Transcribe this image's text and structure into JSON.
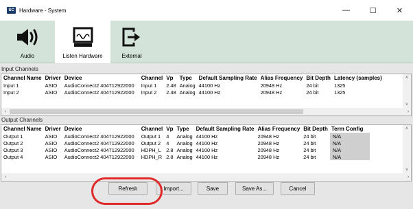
{
  "window": {
    "app_icon_text": "SC",
    "title": "Hardware - System",
    "minimize_glyph": "—",
    "maximize_glyph": "☐",
    "close_glyph": "✕"
  },
  "toolbar": {
    "tools": [
      {
        "label": "Audio",
        "icon": "speaker-icon",
        "active": false
      },
      {
        "label": "Listen Hardware",
        "icon": "monitor-icon",
        "active": true
      },
      {
        "label": "External",
        "icon": "external-arrow-icon",
        "active": false
      }
    ]
  },
  "input_channels": {
    "label": "Input Channels",
    "columns": [
      "Channel Name",
      "Driver",
      "Device",
      "Channel",
      "Vp",
      "Type",
      "Default Sampling Rate",
      "Alias Frequency",
      "Bit Depth",
      "Latency (samples)"
    ],
    "rows": [
      [
        "Input 1",
        "ASIO",
        "AudioConnect2 404712922000",
        "Input 1",
        "2.48",
        "Analog",
        "44100 Hz",
        "20948 Hz",
        "24 bit",
        "1325"
      ],
      [
        "Input 2",
        "ASIO",
        "AudioConnect2 404712922000",
        "Input 2",
        "2.48",
        "Analog",
        "44100 Hz",
        "20948 Hz",
        "24 bit",
        "1325"
      ]
    ]
  },
  "output_channels": {
    "label": "Output Channels",
    "columns": [
      "Channel Name",
      "Driver",
      "Device",
      "Channel",
      "Vp",
      "Type",
      "Default Sampling Rate",
      "Alias Frequency",
      "Bit Depth",
      "Term Config"
    ],
    "rows": [
      [
        "Output 1",
        "ASIO",
        "AudioConnect2 404712922000",
        "Output 1",
        "4",
        "Analog",
        "44100 Hz",
        "20948 Hz",
        "24 bit",
        "N/A"
      ],
      [
        "Output 2",
        "ASIO",
        "AudioConnect2 404712922000",
        "Output 2",
        "4",
        "Analog",
        "44100 Hz",
        "20948 Hz",
        "24 bit",
        "N/A"
      ],
      [
        "Output 3",
        "ASIO",
        "AudioConnect2 404712922000",
        "HDPH_L",
        "2.8",
        "Analog",
        "44100 Hz",
        "20948 Hz",
        "24 bit",
        "N/A"
      ],
      [
        "Output 4",
        "ASIO",
        "AudioConnect2 404712922000",
        "HDPH_R",
        "2.8",
        "Analog",
        "44100 Hz",
        "20948 Hz",
        "24 bit",
        "N/A"
      ]
    ]
  },
  "buttons": {
    "refresh": "Refresh",
    "import": "Import...",
    "save": "Save",
    "save_as": "Save As...",
    "cancel": "Cancel"
  },
  "scroll_glyphs": {
    "up": "˄",
    "down": "˅",
    "left": "‹",
    "right": "›"
  },
  "colors": {
    "toolbar_bg": "#d3e3d9",
    "highlight_circle": "#e02a2a",
    "na_cell": "#cfcfcf"
  }
}
